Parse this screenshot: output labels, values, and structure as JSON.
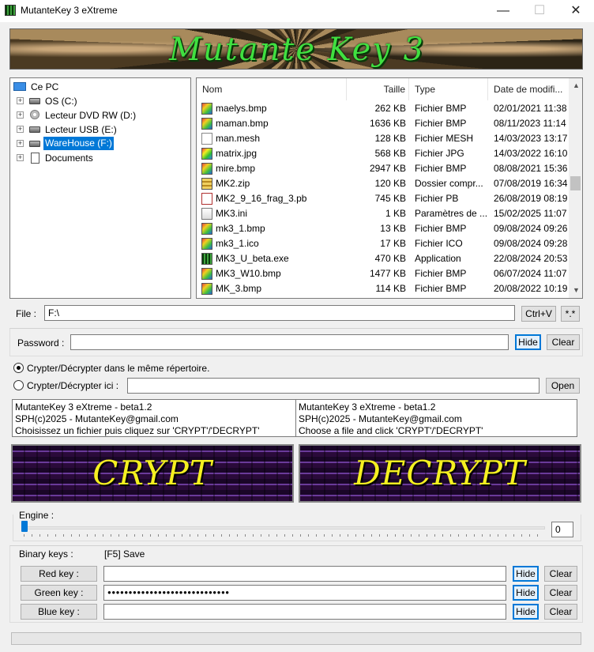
{
  "window": {
    "title": "MutanteKey 3 eXtreme",
    "minimize": "—",
    "maximize": "☐",
    "close": "✕"
  },
  "banner": {
    "title": "Mutante Key 3"
  },
  "tree": {
    "root": "Ce PC",
    "items": [
      {
        "label": "OS (C:)",
        "icon": "drive-icon"
      },
      {
        "label": "Lecteur DVD RW (D:)",
        "icon": "dvd-icon"
      },
      {
        "label": "Lecteur USB (E:)",
        "icon": "usb-drive-icon"
      },
      {
        "label": "WareHouse (F:)",
        "icon": "drive-icon",
        "selected": true
      },
      {
        "label": "Documents",
        "icon": "documents-icon"
      }
    ]
  },
  "files": {
    "columns": [
      "Nom",
      "Taille",
      "Type",
      "Date de modifi..."
    ],
    "rows": [
      {
        "name": "maelys.bmp",
        "size": "262 KB",
        "type": "Fichier BMP",
        "date": "02/01/2021 11:38",
        "icon": "bmp"
      },
      {
        "name": "maman.bmp",
        "size": "1636 KB",
        "type": "Fichier BMP",
        "date": "08/11/2023 11:14",
        "icon": "bmp"
      },
      {
        "name": "man.mesh",
        "size": "128 KB",
        "type": "Fichier MESH",
        "date": "14/03/2023 13:17",
        "icon": "doc"
      },
      {
        "name": "matrix.jpg",
        "size": "568 KB",
        "type": "Fichier JPG",
        "date": "14/03/2022 16:10",
        "icon": "jpg"
      },
      {
        "name": "mire.bmp",
        "size": "2947 KB",
        "type": "Fichier BMP",
        "date": "08/08/2021 15:36",
        "icon": "bmp"
      },
      {
        "name": "MK2.zip",
        "size": "120 KB",
        "type": "Dossier compr...",
        "date": "07/08/2019 16:34",
        "icon": "zip"
      },
      {
        "name": "MK2_9_16_frag_3.pb",
        "size": "745 KB",
        "type": "Fichier PB",
        "date": "26/08/2019 08:19",
        "icon": "pb"
      },
      {
        "name": "MK3.ini",
        "size": "1 KB",
        "type": "Paramètres de ...",
        "date": "15/02/2025 11:07",
        "icon": "ini"
      },
      {
        "name": "mk3_1.bmp",
        "size": "13 KB",
        "type": "Fichier BMP",
        "date": "09/08/2024 09:26",
        "icon": "bmp"
      },
      {
        "name": "mk3_1.ico",
        "size": "17 KB",
        "type": "Fichier ICO",
        "date": "09/08/2024 09:28",
        "icon": "bmp"
      },
      {
        "name": "MK3_U_beta.exe",
        "size": "470 KB",
        "type": "Application",
        "date": "22/08/2024 20:53",
        "icon": "exe"
      },
      {
        "name": "MK3_W10.bmp",
        "size": "1477 KB",
        "type": "Fichier BMP",
        "date": "06/07/2024 11:07",
        "icon": "bmp"
      },
      {
        "name": "MK_3.bmp",
        "size": "114 KB",
        "type": "Fichier BMP",
        "date": "20/08/2022 10:19",
        "icon": "bmp"
      }
    ]
  },
  "file": {
    "label": "File :",
    "value": "F:\\",
    "ctrlv": "Ctrl+V",
    "filter": "*.*"
  },
  "password": {
    "label": "Password :",
    "value": "",
    "hide": "Hide",
    "clear": "Clear"
  },
  "options": {
    "same_dir": "Crypter/Décrypter dans le même répertoire.",
    "here": "Crypter/Décrypter ici :",
    "here_value": "",
    "open": "Open"
  },
  "messages": {
    "left": [
      "MutanteKey 3 eXtreme - beta1.2",
      "SPH(c)2025 - MutanteKey@gmail.com",
      "Choisissez un fichier puis cliquez sur 'CRYPT'/'DECRYPT'"
    ],
    "right": [
      "MutanteKey 3 eXtreme - beta1.2",
      "SPH(c)2025 - MutanteKey@gmail.com",
      "Choose a file and click 'CRYPT'/'DECRYPT'"
    ]
  },
  "actions": {
    "crypt": "CRYPT",
    "decrypt": "DECRYPT"
  },
  "engine": {
    "label": "Engine :",
    "value": "0"
  },
  "keys": {
    "label": "Binary keys :",
    "save": "[F5] Save",
    "red": {
      "label": "Red key :",
      "value": "",
      "hide": "Hide",
      "clear": "Clear"
    },
    "green": {
      "label": "Green key :",
      "value": "●●●●●●●●●●●●●●●●●●●●●●●●●●●●●",
      "hide": "Hide",
      "clear": "Clear"
    },
    "blue": {
      "label": "Blue key :",
      "value": "",
      "hide": "Hide",
      "clear": "Clear"
    }
  }
}
